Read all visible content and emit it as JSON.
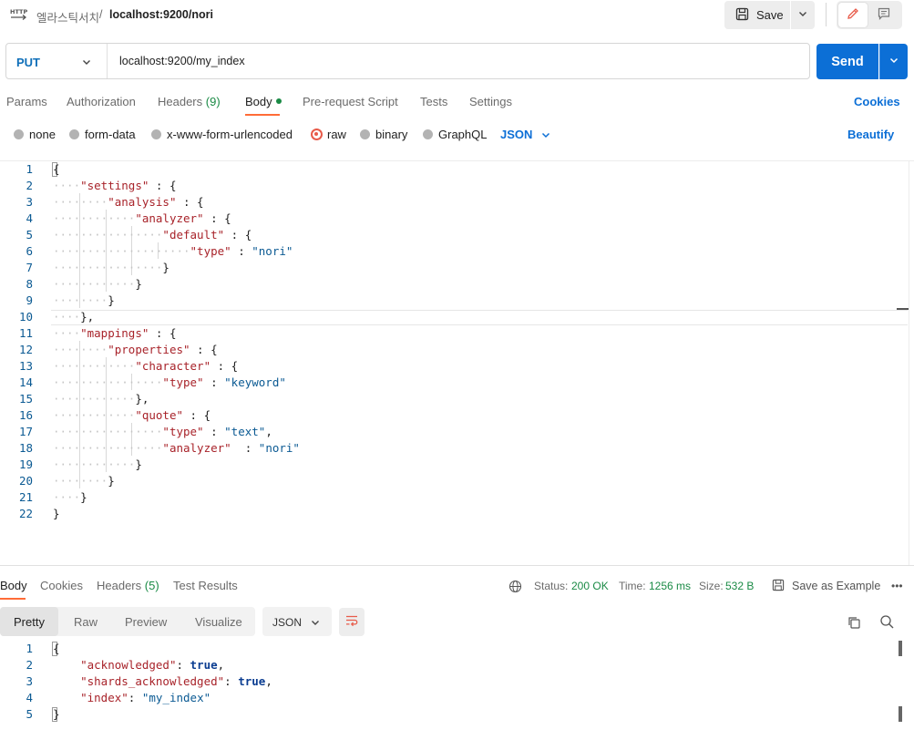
{
  "header": {
    "breadcrumb_parent": "엘라스틱서치",
    "breadcrumb_sep": "/",
    "breadcrumb_current": "localhost:9200/nori",
    "save_label": "Save",
    "icons": [
      "http-icon",
      "save-icon",
      "chevron-down-icon",
      "pencil-icon",
      "comment-icon"
    ]
  },
  "request": {
    "method": "PUT",
    "url": "localhost:9200/my_index",
    "send_label": "Send"
  },
  "tabs": {
    "params": "Params",
    "authorization": "Authorization",
    "headers": "Headers",
    "headers_count": "(9)",
    "body": "Body",
    "prerequest": "Pre-request Script",
    "tests": "Tests",
    "settings": "Settings",
    "cookies": "Cookies"
  },
  "body_options": {
    "none": "none",
    "form_data": "form-data",
    "urlencoded": "x-www-form-urlencoded",
    "raw": "raw",
    "binary": "binary",
    "graphql": "GraphQL",
    "format": "JSON",
    "beautify": "Beautify",
    "selected": "raw"
  },
  "editor": {
    "line_numbers": [
      "1",
      "2",
      "3",
      "4",
      "5",
      "6",
      "7",
      "8",
      "9",
      "10",
      "11",
      "12",
      "13",
      "14",
      "15",
      "16",
      "17",
      "18",
      "19",
      "20",
      "21",
      "22"
    ],
    "tokens": {
      "settings": "\"settings\"",
      "analysis": "\"analysis\"",
      "analyzer": "\"analyzer\"",
      "default": "\"default\"",
      "type": "\"type\"",
      "nori": "\"nori\"",
      "mappings": "\"mappings\"",
      "properties": "\"properties\"",
      "character": "\"character\"",
      "keyword": "\"keyword\"",
      "quote": "\"quote\"",
      "text": "\"text\""
    }
  },
  "response": {
    "tabs": {
      "body": "Body",
      "cookies": "Cookies",
      "headers": "Headers",
      "headers_count": "(5)",
      "test_results": "Test Results"
    },
    "status_label": "Status:",
    "status_value": "200 OK",
    "time_label": "Time:",
    "time_value": "1256 ms",
    "size_label": "Size:",
    "size_value": "532 B",
    "save_example": "Save as Example",
    "more": "•••",
    "views": {
      "pretty": "Pretty",
      "raw": "Raw",
      "preview": "Preview",
      "visualize": "Visualize"
    },
    "format": "JSON",
    "line_numbers": [
      "1",
      "2",
      "3",
      "4",
      "5"
    ],
    "lines": {
      "open": "{",
      "k1": "\"acknowledged\"",
      "v1": "true",
      "k2": "\"shards_acknowledged\"",
      "v2": "true",
      "k3": "\"index\"",
      "v3": "\"my_index\"",
      "close": "}"
    }
  },
  "colors": {
    "accent": "#ff6c37",
    "primary": "#0c6fd6",
    "success": "#1a8a45",
    "json_key": "#a8232a",
    "json_string": "#0b5a93"
  }
}
